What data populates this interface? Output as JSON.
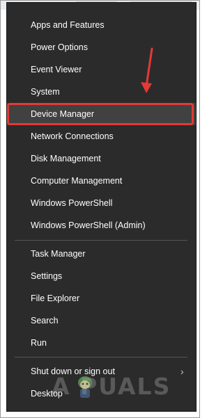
{
  "menu": {
    "groups": [
      {
        "items": [
          {
            "label": "Apps and Features"
          },
          {
            "label": "Power Options"
          },
          {
            "label": "Event Viewer"
          },
          {
            "label": "System"
          },
          {
            "label": "Device Manager",
            "highlighted": true
          },
          {
            "label": "Network Connections"
          },
          {
            "label": "Disk Management"
          },
          {
            "label": "Computer Management"
          },
          {
            "label": "Windows PowerShell"
          },
          {
            "label": "Windows PowerShell (Admin)"
          }
        ]
      },
      {
        "items": [
          {
            "label": "Task Manager"
          },
          {
            "label": "Settings"
          },
          {
            "label": "File Explorer"
          },
          {
            "label": "Search"
          },
          {
            "label": "Run"
          }
        ]
      },
      {
        "items": [
          {
            "label": "Shut down or sign out",
            "has_submenu": true
          },
          {
            "label": "Desktop"
          }
        ]
      }
    ]
  },
  "annotation": {
    "arrow_color": "#e53935",
    "highlight_color": "#e53935"
  },
  "watermark": {
    "text": "A PUALS"
  },
  "colors": {
    "menu_background": "#2b2b2b",
    "menu_text": "#ffffff",
    "hover_background": "#414141",
    "separator": "#555555"
  }
}
